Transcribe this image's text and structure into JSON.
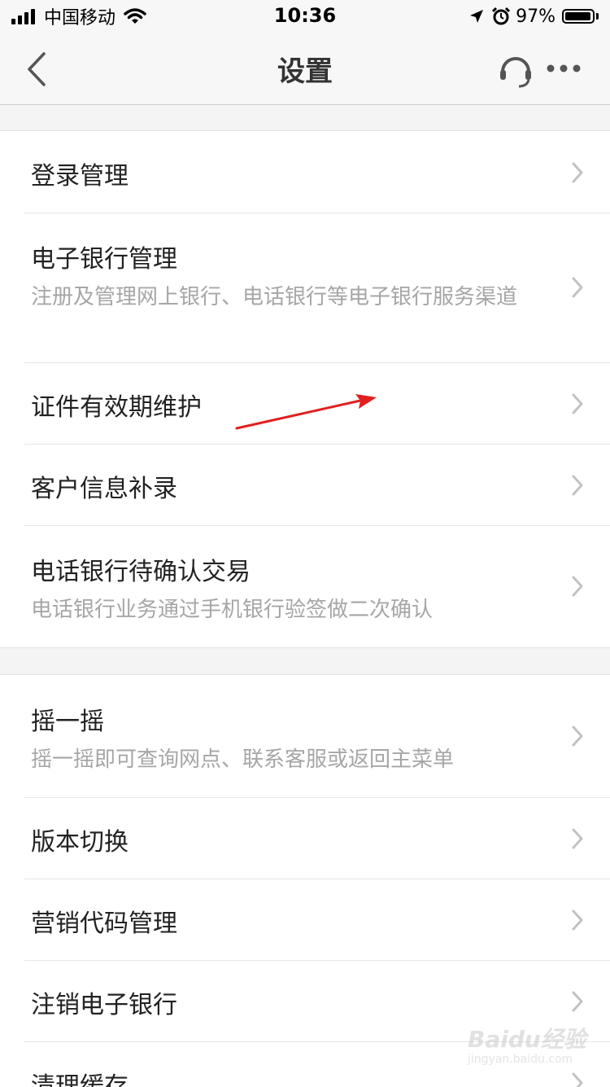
{
  "status": {
    "carrier": "中国移动",
    "time": "10:36",
    "battery": "97%",
    "battery_level": 0.97
  },
  "nav": {
    "title": "设置",
    "back_icon": "chevron-left-icon",
    "service_icon": "headset-icon",
    "more_icon": "more-icon"
  },
  "group1": [
    {
      "title": "登录管理"
    },
    {
      "title": "电子银行管理",
      "subtitle": "注册及管理网上银行、电话银行等电子银行服务渠道"
    },
    {
      "title": "证件有效期维护"
    },
    {
      "title": "客户信息补录"
    },
    {
      "title": "电话银行待确认交易",
      "subtitle": "电话银行业务通过手机银行验签做二次确认"
    }
  ],
  "group2": [
    {
      "title": "摇一摇",
      "subtitle": "摇一摇即可查询网点、联系客服或返回主菜单"
    },
    {
      "title": "版本切换"
    },
    {
      "title": "营销代码管理"
    },
    {
      "title": "注销电子银行"
    },
    {
      "title": "清理缓存"
    }
  ],
  "watermark": {
    "text": "Baidu经验",
    "sub": "jingyan.baidu.com"
  },
  "colors": {
    "annotation_arrow": "#e02020"
  }
}
